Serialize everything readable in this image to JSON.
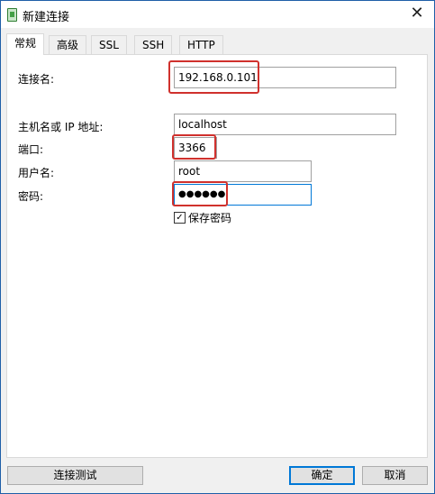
{
  "window": {
    "title": "新建连接",
    "close_icon": "close-icon"
  },
  "tabs": [
    {
      "label": "常规",
      "active": true
    },
    {
      "label": "高级"
    },
    {
      "label": "SSL"
    },
    {
      "label": "SSH"
    },
    {
      "label": "HTTP"
    }
  ],
  "form": {
    "connection_name_label": "连接名:",
    "connection_name_value": "192.168.0.101",
    "host_label": "主机名或 IP 地址:",
    "host_value": "localhost",
    "port_label": "端口:",
    "port_value": "3366",
    "user_label": "用户名:",
    "user_value": "root",
    "password_label": "密码:",
    "password_value": "●●●●●●",
    "save_password_label": "保存密码",
    "save_password_checked": true
  },
  "buttons": {
    "test": "连接测试",
    "ok": "确定",
    "cancel": "取消"
  },
  "colors": {
    "highlight": "#d0312d",
    "focus": "#0078d7"
  }
}
